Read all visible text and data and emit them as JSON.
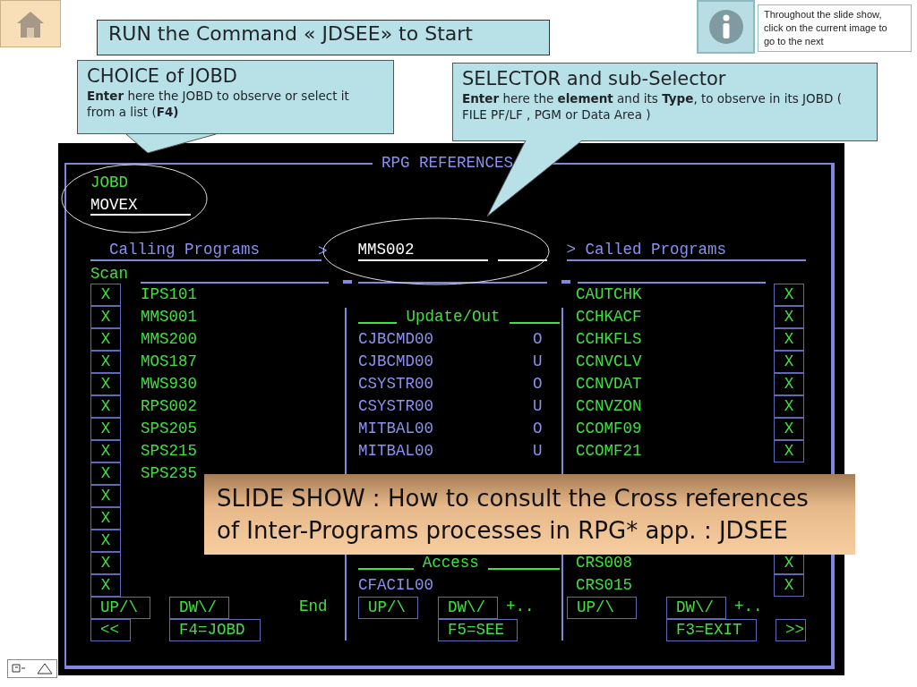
{
  "slide": {
    "note": "Throughout the slide show, click on the current image to go to the next",
    "title": "RUN the Command « JDSEE»  to Start",
    "callouts": [
      {
        "title": "CHOICE of JOBD",
        "text": "**Enter** here the JOBD to observe or select it from a list (**F4)**"
      },
      {
        "title": "SELECTOR and sub-Selector",
        "text": "**Enter** here the **element**  and its **Type**, to observe in its JOBD ( FILE PF/LF , PGM or Data Area )"
      }
    ],
    "banner": [
      "SLIDE SHOW : How to consult the Cross references",
      "of Inter-Programs processes in RPG* app. :  JDSEE"
    ]
  },
  "terminal": {
    "title": "RPG REFERENCES",
    "jobd_label": "JOBD",
    "jobd_value": "MOVEX",
    "calling_header": "Calling Programs",
    "calling_arrow": ">",
    "selector_value": "MMS002",
    "called_header": "> Called Programs",
    "scan_label": "Scan",
    "rows": [
      {
        "calling": {
          "option": "X",
          "name": "IPS101"
        },
        "called": {
          "name": "CAUTCHK",
          "option": "X"
        }
      },
      {
        "calling": {
          "option": "X",
          "name": "MMS001"
        },
        "reference": {
          "kind": "heading",
          "name": "Update/Out"
        },
        "called": {
          "name": "CCHKACF",
          "option": "X"
        }
      },
      {
        "calling": {
          "option": "X",
          "name": "MMS200"
        },
        "reference": {
          "kind": "item",
          "name": "CJBCMD00",
          "usage": "O"
        },
        "called": {
          "name": "CCHKFLS",
          "option": "X"
        }
      },
      {
        "calling": {
          "option": "X",
          "name": "MOS187"
        },
        "reference": {
          "kind": "item",
          "name": "CJBCMD00",
          "usage": "U"
        },
        "called": {
          "name": "CCNVCLV",
          "option": "X"
        }
      },
      {
        "calling": {
          "option": "X",
          "name": "MWS930"
        },
        "reference": {
          "kind": "item",
          "name": "CSYSTR00",
          "usage": "O"
        },
        "called": {
          "name": "CCNVDAT",
          "option": "X"
        }
      },
      {
        "calling": {
          "option": "X",
          "name": "RPS002"
        },
        "reference": {
          "kind": "item",
          "name": "CSYSTR00",
          "usage": "U"
        },
        "called": {
          "name": "CCNVZON",
          "option": "X"
        }
      },
      {
        "calling": {
          "option": "X",
          "name": "SPS205"
        },
        "reference": {
          "kind": "item",
          "name": "MITBAL00",
          "usage": "O"
        },
        "called": {
          "name": "CCOMF09",
          "option": "X"
        }
      },
      {
        "calling": {
          "option": "X",
          "name": "SPS215"
        },
        "reference": {
          "kind": "item",
          "name": "MITBAL00",
          "usage": "U"
        },
        "called": {
          "name": "CCOMF21",
          "option": "X"
        }
      },
      {
        "calling": {
          "option": "X",
          "name": "SPS235"
        }
      },
      {
        "calling": {
          "option": "X"
        }
      },
      {
        "calling": {
          "option": "X"
        }
      },
      {
        "calling": {
          "option": "X"
        }
      },
      {
        "calling": {
          "option": "X"
        },
        "reference": {
          "kind": "heading",
          "name": "Access"
        },
        "called": {
          "name": "CRS008",
          "option": "X"
        }
      },
      {
        "calling": {
          "option": "X"
        },
        "reference": {
          "kind": "item",
          "name": "CFACIL00"
        },
        "called": {
          "name": "CRS015",
          "option": "X"
        }
      }
    ],
    "keys": [
      [
        {
          "kind": "key",
          "label": "UP/\\"
        },
        {
          "kind": "key",
          "label": "DW\\/"
        },
        {
          "kind": "text",
          "label": "End"
        },
        {
          "kind": "key",
          "label": "UP/\\"
        },
        {
          "kind": "key",
          "label": "DW\\/"
        },
        {
          "kind": "text",
          "label": "+.."
        },
        {
          "kind": "key",
          "label": "UP/\\"
        },
        {
          "kind": "key",
          "label": "DW\\/"
        },
        {
          "kind": "text",
          "label": "+.."
        }
      ],
      [
        {
          "kind": "key",
          "label": "<<"
        },
        {
          "kind": "key",
          "label": "F4=JOBD"
        },
        {
          "kind": "key",
          "label": "F5=SEE"
        },
        {
          "kind": "key",
          "label": "F3=EXIT"
        },
        {
          "kind": "key",
          "label": ">>"
        }
      ]
    ]
  }
}
